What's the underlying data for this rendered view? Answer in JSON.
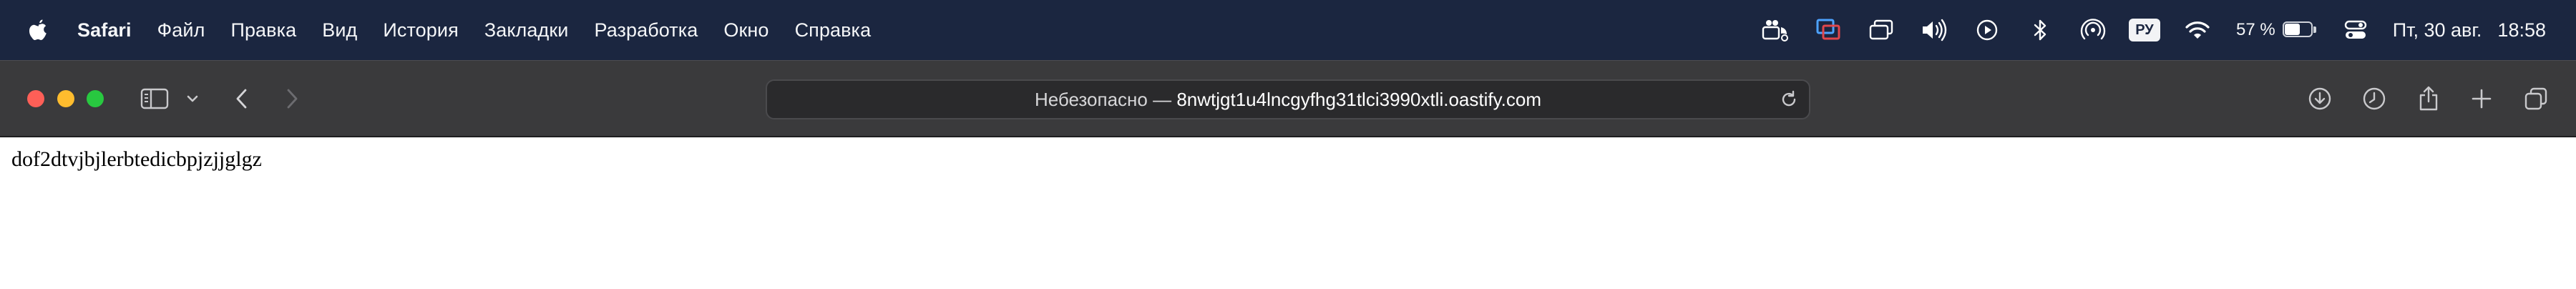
{
  "menubar": {
    "apple_icon": "apple-logo-icon",
    "app_name": "Safari",
    "items": [
      "Файл",
      "Правка",
      "Вид",
      "История",
      "Закладки",
      "Разработка",
      "Окно",
      "Справка"
    ],
    "status": {
      "icons": [
        "stage-manager-icon",
        "screen-share-icon",
        "window-icon",
        "volume-icon",
        "play-icon",
        "bluetooth-icon",
        "airdrop-icon"
      ],
      "input_language": "РУ",
      "wifi_icon": "wifi-icon",
      "battery_percent_text": "57 %",
      "battery_level": 0.57,
      "control_center_icon": "control-center-icon",
      "date": "Пт, 30 авг.",
      "time": "18:58"
    }
  },
  "toolbar": {
    "sidebar_icon": "sidebar-icon",
    "sidebar_menu_icon": "chevron-down-icon",
    "back_icon": "chevron-left-icon",
    "forward_icon": "chevron-right-icon",
    "address": {
      "security_label": "Небезопасно —",
      "host": "8nwtjgt1u4lncgyfhg31tlci3990xtli.oastify.com",
      "reload_icon": "reload-icon"
    },
    "right_icons": [
      "download-icon",
      "history-icon",
      "share-icon",
      "new-tab-icon",
      "tab-overview-icon"
    ]
  },
  "page": {
    "body_text": "dof2dtvjbjlerbtedicbpjzjjglgz"
  },
  "colors": {
    "menubar_bg": "#1b2640",
    "toolbar_bg": "#3a3a3c",
    "close": "#fe5f57",
    "minimize": "#febc2e",
    "maximize": "#28c840"
  }
}
